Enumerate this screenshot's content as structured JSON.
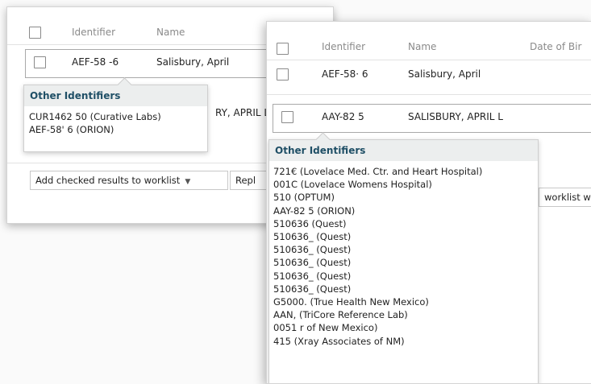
{
  "back_panel": {
    "columns": [
      "Identifier",
      "Name"
    ],
    "row": {
      "identifier": "AEF-58  -6",
      "name": "Salisbury, April"
    },
    "partial_name": "RY, APRIL L",
    "popover": {
      "title": "Other Identifiers",
      "items": [
        "CUR1462     50 (Curative Labs)",
        "AEF-58'     6 (ORION)"
      ]
    },
    "worklist_select": "Add checked results to worklist",
    "replace_partial": "Repl"
  },
  "front_panel": {
    "columns": [
      "Identifier",
      "Name",
      "Date of Bir"
    ],
    "rows": [
      {
        "identifier": "AEF-58·    6",
        "name": "Salisbury, April"
      },
      {
        "identifier": "AAY-82     5",
        "name": "SALISBURY, APRIL L"
      }
    ],
    "worklist_partial": "worklist w",
    "popover": {
      "title": "Other Identifiers",
      "items": [
        "721€    (Lovelace Med. Ctr. and Heart Hospital)",
        "001C      (Lovelace Womens Hospital)",
        "510      (OPTUM)",
        "AAY-82        5 (ORION)",
        "510636 (Quest)",
        "510636_           (Quest)",
        "510636_        (Quest)",
        "510636_        (Quest)",
        "510636_         (Quest)",
        "510636_         (Quest)",
        "G5000.          (True Health New Mexico)",
        "AAN,       (TriCore Reference Lab)",
        "0051        r of New Mexico)",
        "415      (Xray Associates of NM)"
      ]
    }
  }
}
